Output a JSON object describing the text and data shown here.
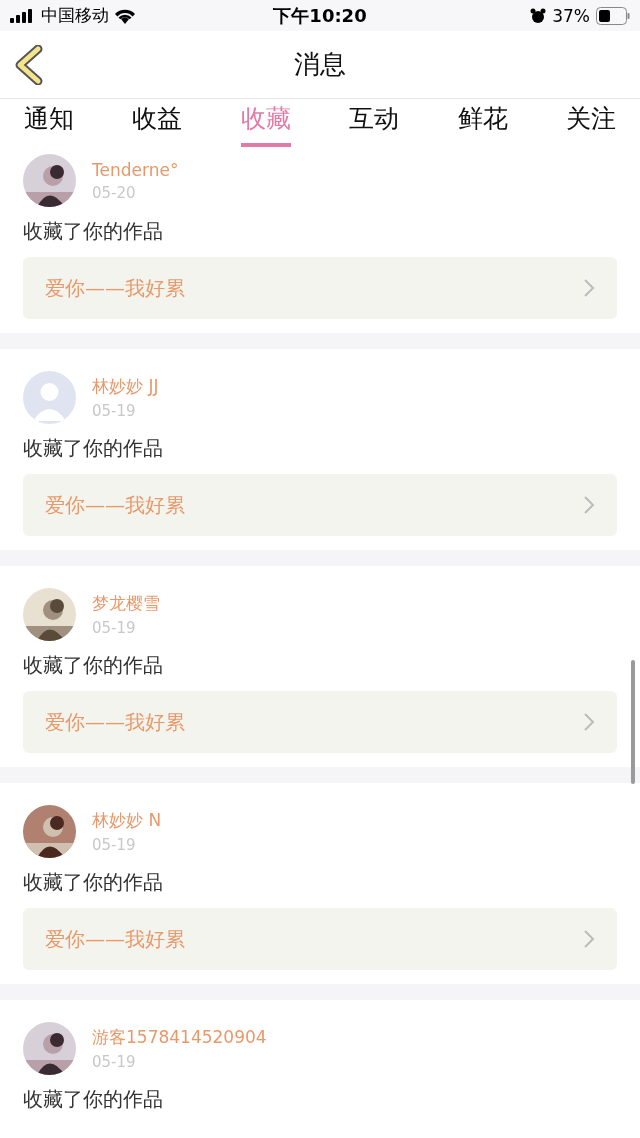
{
  "status_bar": {
    "carrier": "中国移动",
    "time": "下午10:20",
    "battery": "37%"
  },
  "nav": {
    "title": "消息"
  },
  "tabs": [
    {
      "label": "通知",
      "selected": false
    },
    {
      "label": "收益",
      "selected": false
    },
    {
      "label": "收藏",
      "selected": true
    },
    {
      "label": "互动",
      "selected": false
    },
    {
      "label": "鲜花",
      "selected": false
    },
    {
      "label": "关注",
      "selected": false
    }
  ],
  "messages": [
    {
      "kind": "picture",
      "name": "Tenderne°",
      "date": "05-20",
      "text": "收藏了你的作品",
      "work": "爱你——我好累"
    },
    {
      "kind": "default",
      "name": "林妙妙 JJ",
      "date": "05-19",
      "text": "收藏了你的作品",
      "work": "爱你——我好累"
    },
    {
      "kind": "picture",
      "name": "梦龙樱雪",
      "date": "05-19",
      "text": "收藏了你的作品",
      "work": "爱你——我好累"
    },
    {
      "kind": "picture",
      "name": "林妙妙 N",
      "date": "05-19",
      "text": "收藏了你的作品",
      "work": "爱你——我好累"
    },
    {
      "kind": "picture",
      "name": "游客1578414520904",
      "date": "05-19",
      "text": "收藏了你的作品"
    }
  ]
}
